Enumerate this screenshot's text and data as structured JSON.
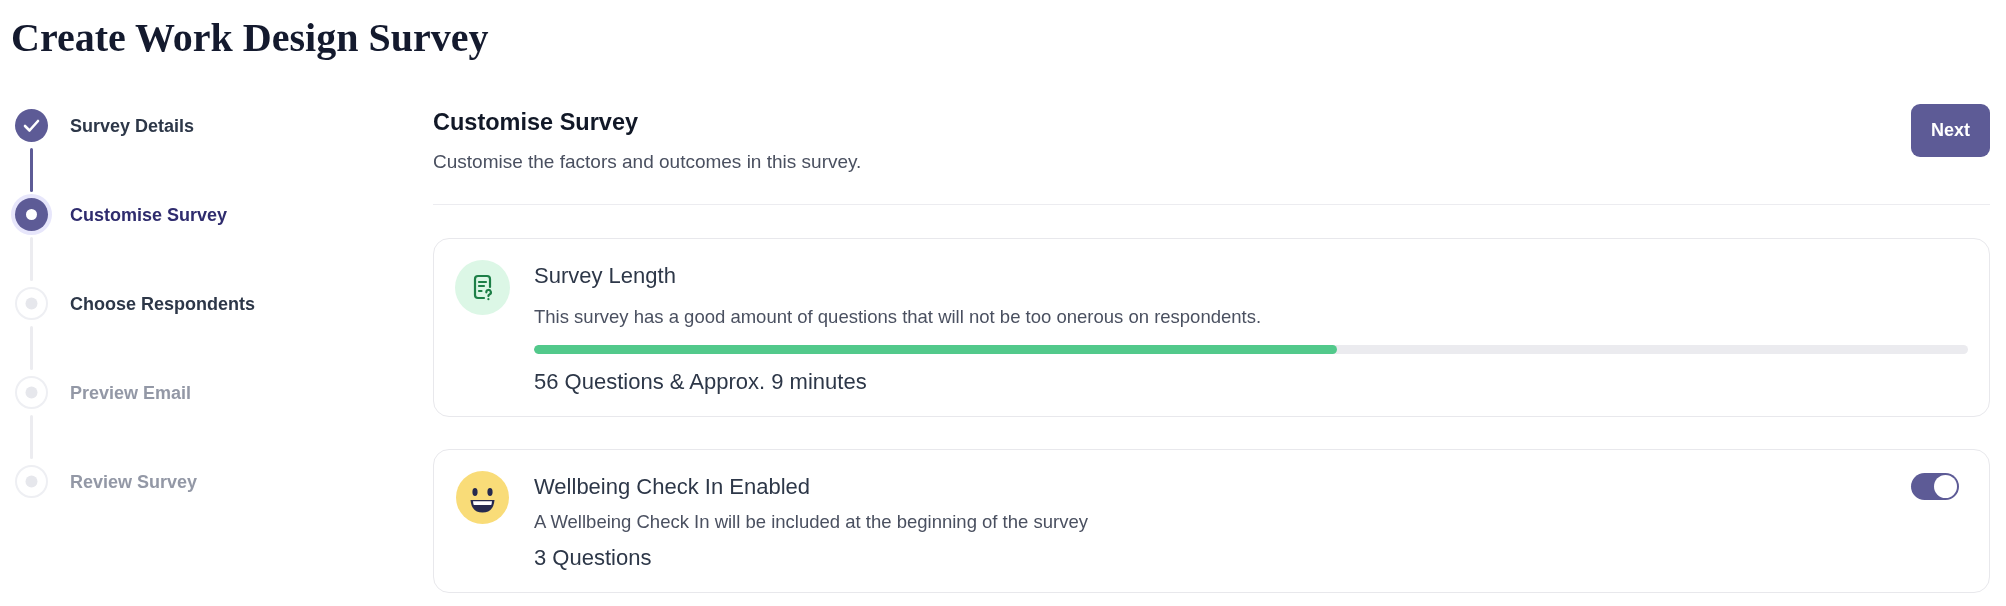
{
  "title": "Create Work Design Survey",
  "steps": [
    {
      "label": "Survey Details",
      "completed": true,
      "selected": false,
      "disabled": false
    },
    {
      "label": "Customise Survey",
      "completed": false,
      "selected": true,
      "disabled": false
    },
    {
      "label": "Choose Respondents",
      "completed": false,
      "selected": false,
      "disabled": false
    },
    {
      "label": "Preview Email",
      "completed": false,
      "selected": false,
      "disabled": true
    },
    {
      "label": "Review Survey",
      "completed": false,
      "selected": false,
      "disabled": true
    }
  ],
  "section": {
    "title": "Customise Survey",
    "subtitle": "Customise the factors and outcomes in this survey.",
    "next_button": "Next"
  },
  "cards": [
    {
      "kind": "progress",
      "title": "Survey Length",
      "description": "This survey has a good amount of questions that will not be too onerous on respondents.",
      "level": 0.56,
      "summary": "56 Questions & Approx. 9 minutes"
    },
    {
      "kind": "toggle",
      "title": "Wellbeing Check In Enabled",
      "description": "A Wellbeing Check In will be included at the beginning of the survey",
      "on": true,
      "summary": "3 Questions"
    }
  ]
}
